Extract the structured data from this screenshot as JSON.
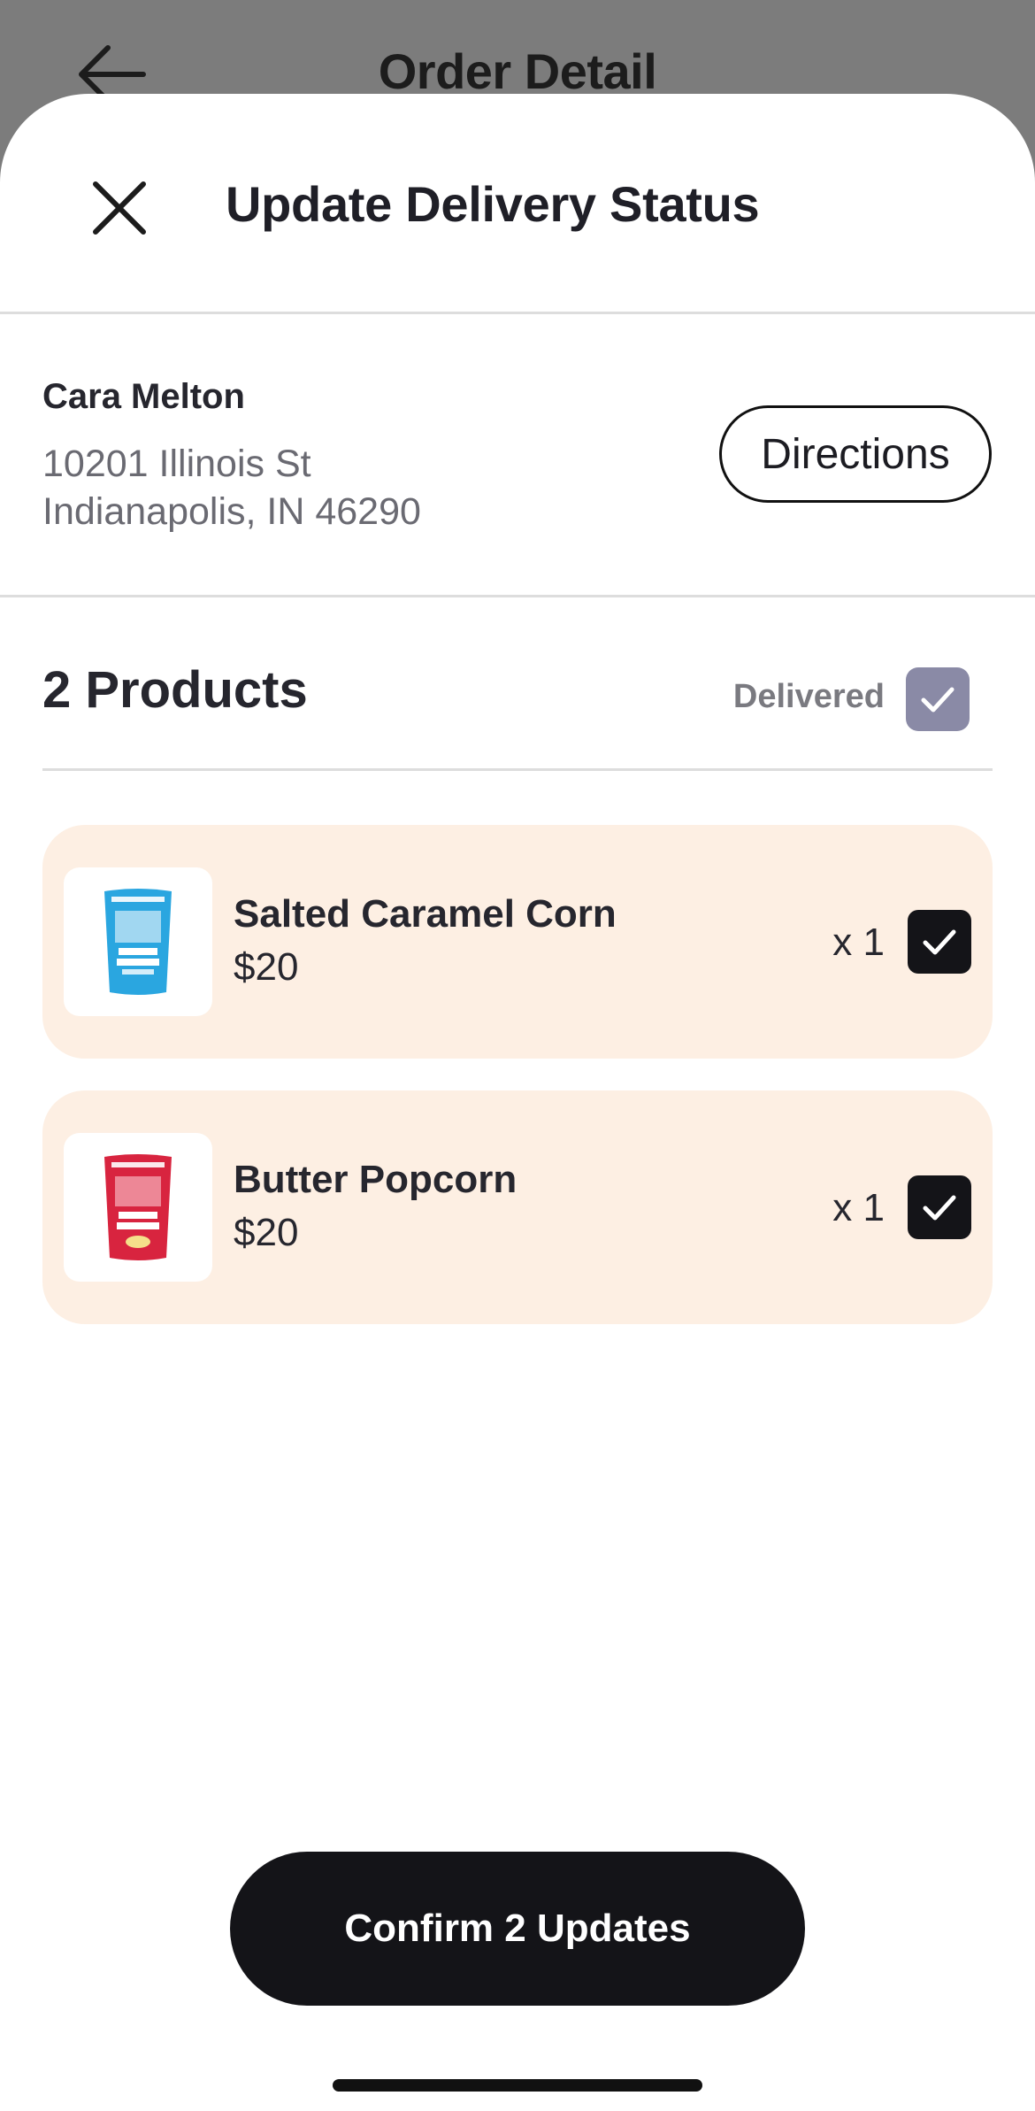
{
  "underlay": {
    "title": "Order Detail"
  },
  "sheet": {
    "title": "Update Delivery Status"
  },
  "customer": {
    "name": "Cara Melton",
    "address_line1": "10201 Illinois St",
    "address_line2": "Indianapolis, IN 46290",
    "directions_label": "Directions"
  },
  "products": {
    "count_label": "2 Products",
    "delivered_label": "Delivered",
    "items": [
      {
        "name": "Salted Caramel Corn",
        "price": "$20",
        "quantity": "x 1",
        "checked": true,
        "bag_color": "#2aa6e0"
      },
      {
        "name": "Butter Popcorn",
        "price": "$20",
        "quantity": "x 1",
        "checked": true,
        "bag_color": "#d8243f"
      }
    ]
  },
  "confirm_label": "Confirm 2 Updates",
  "colors": {
    "card_background": "#fdefe3",
    "primary_dark": "#141418",
    "delivered_check": "#8a8aa6"
  }
}
